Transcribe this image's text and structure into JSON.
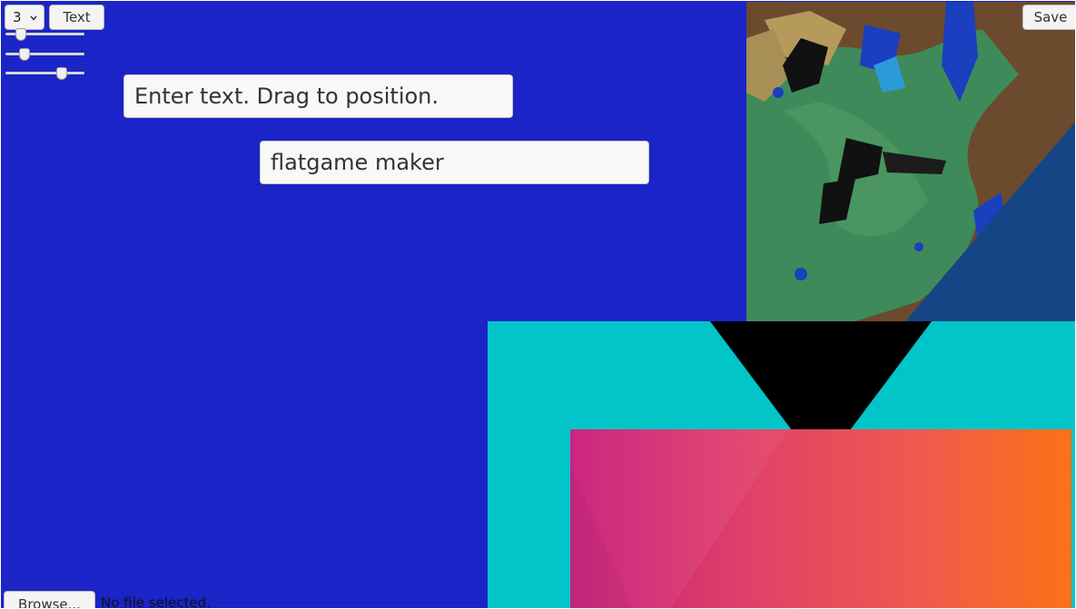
{
  "toolbar": {
    "layer_value": "3",
    "text_button_label": "Text",
    "save_button_label": "Save"
  },
  "sliders": [
    {
      "value": 0.15
    },
    {
      "value": 0.2
    },
    {
      "value": 0.75
    }
  ],
  "text_fields": [
    {
      "value": "Enter text. Drag to position."
    },
    {
      "value": "flatgame maker"
    }
  ],
  "file_input": {
    "button_label": "Browse...",
    "status": "No file selected."
  },
  "colors": {
    "background": "#1b24c7",
    "cyan_shape": "#02c5c8",
    "triangle": "#000000",
    "gradient_start": "#c91b7c",
    "gradient_end": "#fc7217"
  }
}
